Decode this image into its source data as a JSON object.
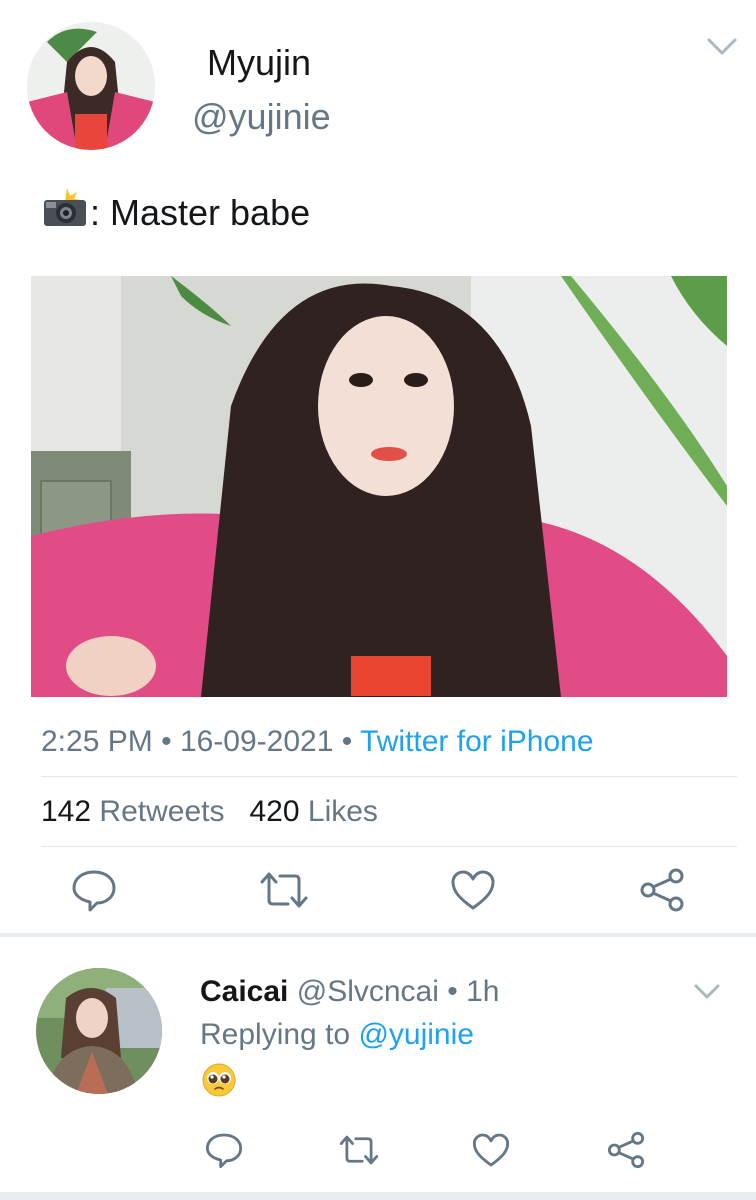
{
  "tweet": {
    "author_name": "Myujin",
    "author_handle": "@yujinie",
    "text": ": Master babe",
    "camera_icon": "camera-flash-icon",
    "time": "2:25 PM",
    "date": "16-09-2021",
    "source": "Twitter for iPhone",
    "separator": "•",
    "retweets_count": "142",
    "retweets_label": "Retweets",
    "likes_count": "420",
    "likes_label": "Likes"
  },
  "reply": {
    "author_name": "Caicai",
    "author_handle": "@Slvcncai",
    "separator": "•",
    "time_ago": "1h",
    "replying_prefix": "Replying to",
    "replying_handle": "@yujinie",
    "emoji_icon": "pleading-face-emoji"
  },
  "colors": {
    "accent": "#1da1f2",
    "secondary_text": "#657786",
    "primary_text": "#14171a",
    "divider": "#e1e8ed"
  }
}
